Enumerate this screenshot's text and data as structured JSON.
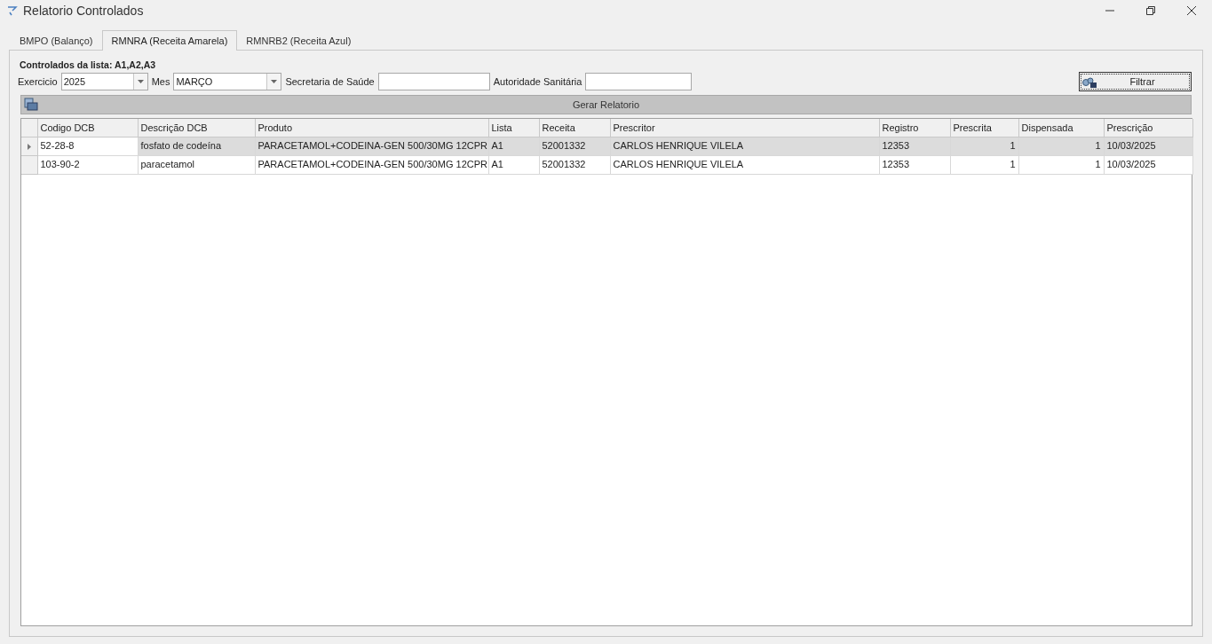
{
  "window": {
    "title": "Relatorio Controlados"
  },
  "tabs": [
    {
      "label": "BMPO (Balanço)",
      "selected": false
    },
    {
      "label": "RMNRA (Receita Amarela)",
      "selected": true
    },
    {
      "label": "RMNRB2 (Receita Azul)",
      "selected": false
    }
  ],
  "heading": "Controlados da lista: A1,A2,A3",
  "filters": [
    {
      "kind": "combo",
      "label": "Exercicio",
      "value": "2025"
    },
    {
      "kind": "combo",
      "label": "Mes",
      "value": "MARÇO"
    },
    {
      "kind": "text",
      "label": "Secretaria de Saúde"
    },
    {
      "kind": "text",
      "label": "Autoridade Sanitária"
    }
  ],
  "filter_button": "Filtrar",
  "generate_bar": "Gerar Relatorio",
  "table": {
    "columns": [
      {
        "label": "Codigo DCB",
        "kind": "text"
      },
      {
        "label": "Descrição DCB",
        "kind": "text"
      },
      {
        "label": "Produto",
        "kind": "text"
      },
      {
        "label": "Lista",
        "kind": "text"
      },
      {
        "label": "Receita",
        "kind": "text"
      },
      {
        "label": "Prescritor",
        "kind": "text"
      },
      {
        "label": "Registro",
        "kind": "text"
      },
      {
        "label": "Prescrita",
        "kind": "number"
      },
      {
        "label": "Dispensada",
        "kind": "number"
      },
      {
        "label": "Prescrição",
        "kind": "text"
      }
    ],
    "rows": [
      {
        "selected": true,
        "cells": [
          "52-28-8",
          "fosfato de codeína",
          "PARACETAMOL+CODEINA-GEN 500/30MG 12CPR",
          "A1",
          "52001332",
          "CARLOS HENRIQUE VILELA",
          "12353",
          "1",
          "1",
          "10/03/2025"
        ]
      },
      {
        "selected": false,
        "cells": [
          "103-90-2",
          "paracetamol",
          "PARACETAMOL+CODEINA-GEN 500/30MG 12CPR",
          "A1",
          "52001332",
          "CARLOS HENRIQUE VILELA",
          "12353",
          "1",
          "1",
          "10/03/2025"
        ]
      }
    ]
  }
}
